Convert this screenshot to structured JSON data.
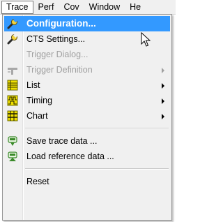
{
  "menubar": {
    "items": [
      {
        "label": "Trace"
      },
      {
        "label": "Perf"
      },
      {
        "label": "Cov"
      },
      {
        "label": "Window"
      },
      {
        "label": "He"
      }
    ]
  },
  "trace_menu": {
    "items": [
      {
        "label": "Configuration...",
        "icon": "wrench-icon",
        "state": "highlighted",
        "submenu": false
      },
      {
        "label": "CTS Settings...",
        "icon": "wrench-icon",
        "state": "enabled",
        "submenu": false
      },
      {
        "label": "Trigger Dialog...",
        "icon": "",
        "state": "disabled",
        "submenu": false
      },
      {
        "label": "Trigger Definition",
        "icon": "trigger-icon",
        "state": "disabled",
        "submenu": true
      },
      {
        "label": "List",
        "icon": "list-icon",
        "state": "enabled",
        "submenu": true
      },
      {
        "label": "Timing",
        "icon": "timing-icon",
        "state": "enabled",
        "submenu": true
      },
      {
        "label": "Chart",
        "icon": "chart-icon",
        "state": "enabled",
        "submenu": true
      },
      {
        "label": "Save trace data ...",
        "icon": "save-icon",
        "state": "enabled",
        "submenu": false
      },
      {
        "label": "Load reference data ...",
        "icon": "load-icon",
        "state": "enabled",
        "submenu": false
      },
      {
        "label": "Reset",
        "icon": "",
        "state": "enabled",
        "submenu": false
      }
    ]
  },
  "colors": {
    "highlight": "#3399ff",
    "menu_background": "#f0f0f0",
    "disabled_text": "#a0a0a0",
    "icon_yellow": "#f0e000",
    "icon_green": "#3a8a2a"
  }
}
